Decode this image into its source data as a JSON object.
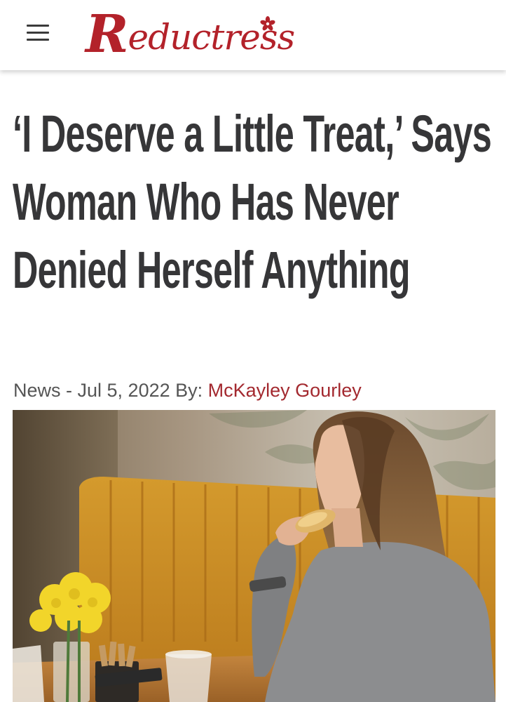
{
  "header": {
    "menu_icon": "hamburger-menu-icon",
    "logo": {
      "text_cap": "R",
      "text_rest": "eductress",
      "flower_icon": "flower-icon",
      "brand_color": "#b3222a"
    }
  },
  "article": {
    "headline": "‘I Deserve a Little Treat,’ Says Woman Who Has Never Denied Herself Anything",
    "category": "News",
    "separator": " - ",
    "date": "Jul 5, 2022",
    "by_label": " By: ",
    "author": "McKayley Gourley",
    "author_color": "#a3292f",
    "headline_color": "#363638"
  }
}
